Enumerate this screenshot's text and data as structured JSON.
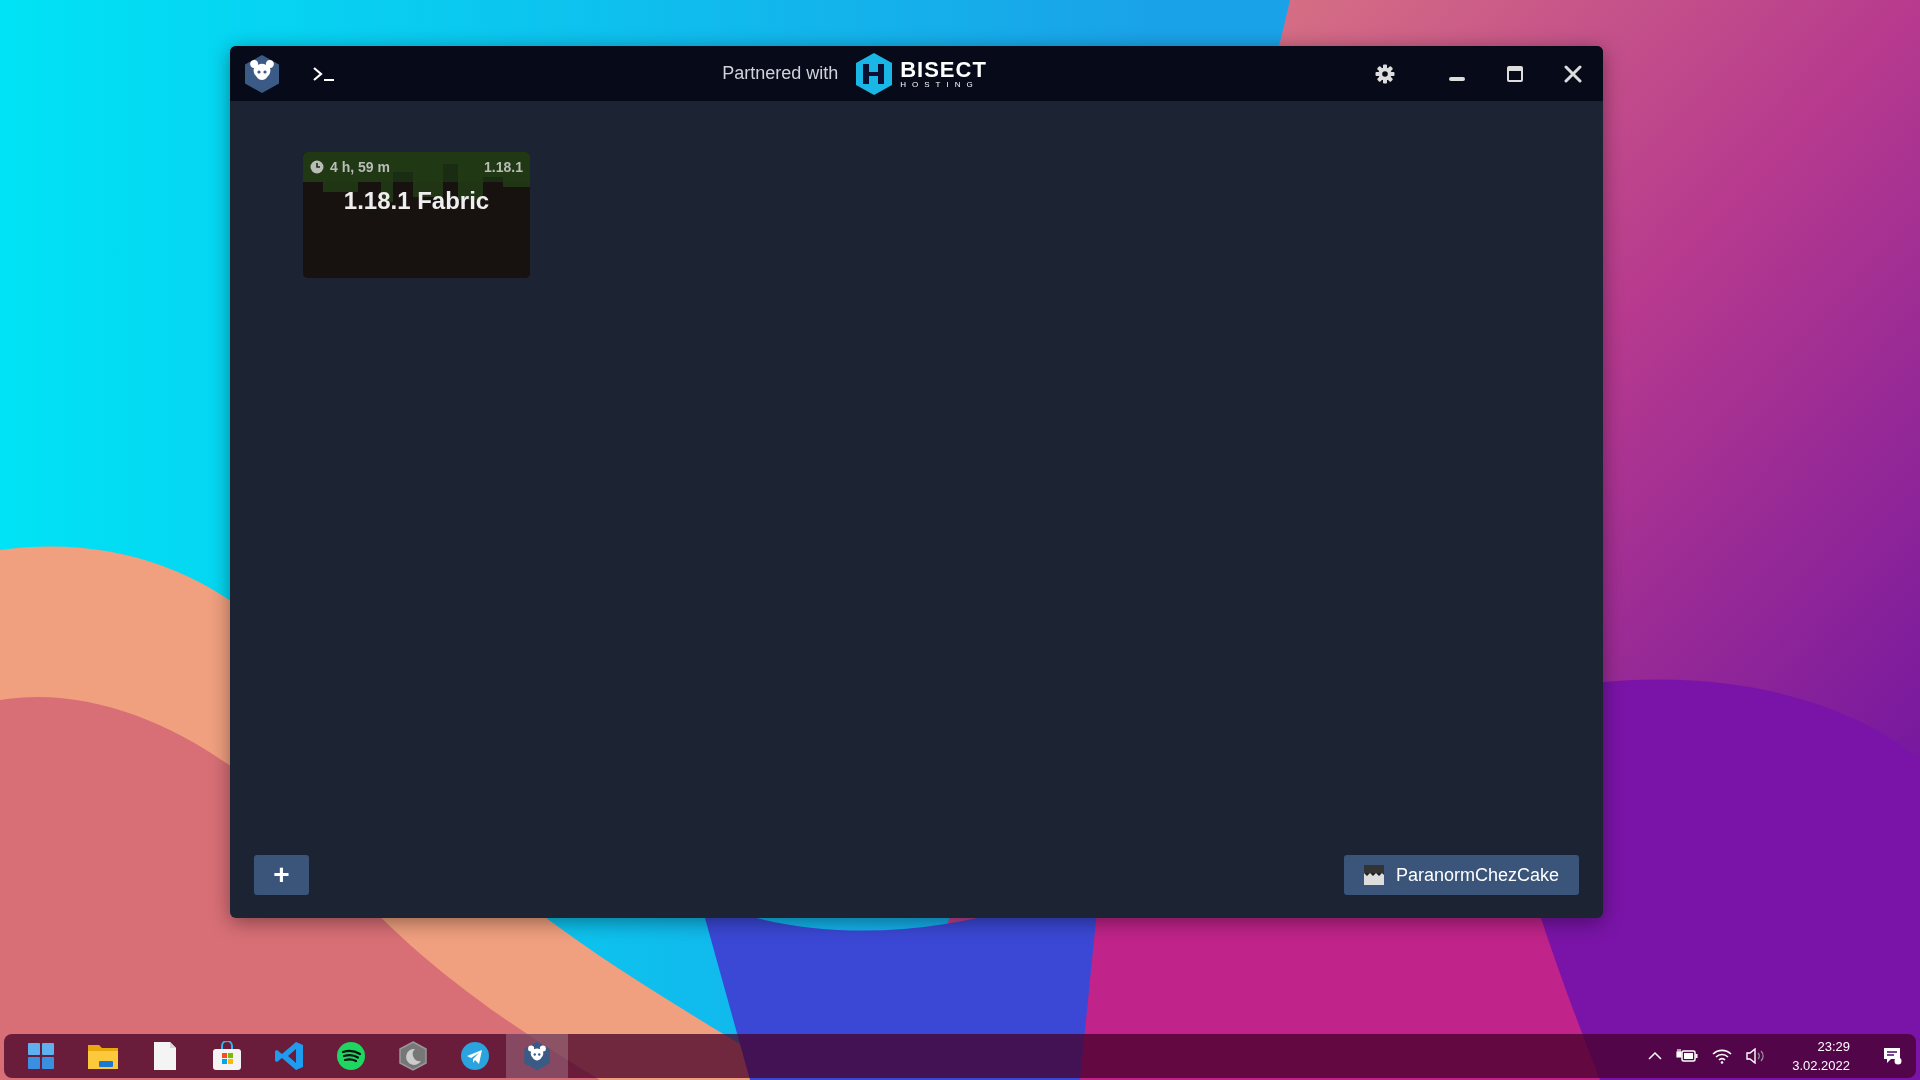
{
  "title_bar": {
    "partner_text": "Partnered with",
    "partner_name": "BISECT",
    "partner_sub": "HOSTING"
  },
  "instances": [
    {
      "name": "1.18.1 Fabric",
      "playtime": "4 h, 59 m",
      "version": "1.18.1"
    }
  ],
  "add_button": {
    "label": "+"
  },
  "account": {
    "name": "ParanormChezCake"
  },
  "taskbar": {
    "apps": [
      {
        "kind": "start",
        "selected": false
      },
      {
        "kind": "folder",
        "selected": false
      },
      {
        "kind": "notepad",
        "selected": false
      },
      {
        "kind": "store",
        "selected": false
      },
      {
        "kind": "code",
        "selected": false
      },
      {
        "kind": "music",
        "selected": false
      },
      {
        "kind": "moon",
        "selected": false
      },
      {
        "kind": "telegram",
        "selected": false
      },
      {
        "kind": "launcher",
        "selected": true
      }
    ],
    "time": "23:29",
    "date": "3.02.2022"
  }
}
